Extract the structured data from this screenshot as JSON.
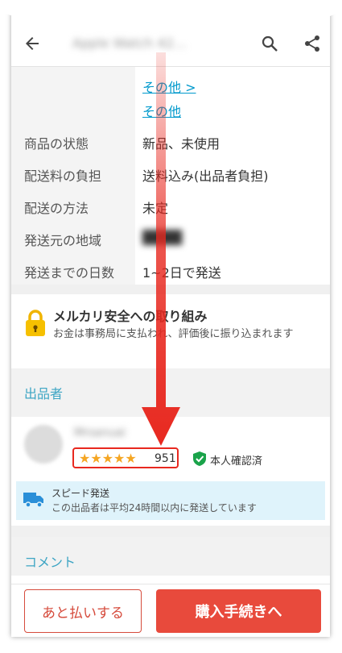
{
  "appbar": {
    "title": "Apple Watch 42…",
    "back_icon": "arrow-left-icon",
    "search_icon": "search-icon",
    "share_icon": "share-icon"
  },
  "details": {
    "category_links": [
      "その他 >",
      "その他"
    ],
    "rows": [
      {
        "label": "商品の状態",
        "value": "新品、未使用"
      },
      {
        "label": "配送料の負担",
        "value": "送料込み(出品者負担)"
      },
      {
        "label": "配送の方法",
        "value": "未定"
      },
      {
        "label": "発送元の地域",
        "value": ""
      },
      {
        "label": "発送までの日数",
        "value": "1~2日で発送"
      }
    ]
  },
  "safety": {
    "title": "メルカリ安全への取り組み",
    "text": "お金は事務局に支払われ、評価後に振り込まれます"
  },
  "seller": {
    "section_title": "出品者",
    "name": "Mrsanuai",
    "stars": "★★★★★",
    "rating_count": "951",
    "verified_label": "本人確認済",
    "speed_title": "スピード発送",
    "speed_text": "この出品者は平均24時間以内に発送しています"
  },
  "comment": {
    "section_title": "コメント"
  },
  "actions": {
    "later_pay": "あと払いする",
    "buy": "購入手続きへ"
  },
  "colors": {
    "accent": "#e84a3c",
    "link": "#0099cc",
    "section": "#3da5c4",
    "star": "#f5a623",
    "verified": "#1aa34a",
    "highlight_arrow": "#e8281f"
  }
}
